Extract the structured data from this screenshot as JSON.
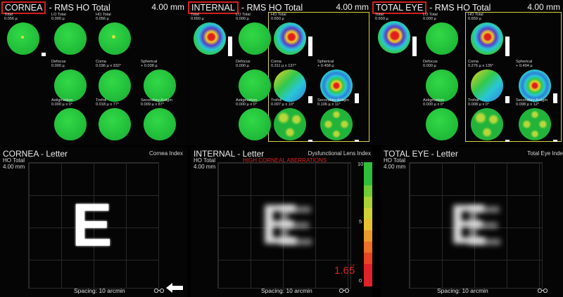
{
  "distance": "4.00 mm",
  "cornea_top": {
    "title": "CORNEA",
    "subtitle": "- RMS HO Total",
    "cells": [
      {
        "name": "Total",
        "value": "0.056 µ"
      },
      {
        "name": "LO Total",
        "value": "0.000 µ"
      },
      {
        "name": "HO Total",
        "value": "0.056 µ"
      },
      {
        "name": "Defocus",
        "value": "0.000 µ"
      },
      {
        "name": "Coma",
        "value": "0.036 µ x 332°"
      },
      {
        "name": "Spherical",
        "value": "+ 0.038 µ"
      },
      {
        "name": "Astigmatism",
        "value": "0.000 µ x 0°"
      },
      {
        "name": "Trefoil",
        "value": "0.018 µ x 77°"
      },
      {
        "name": "Secondary Astigm",
        "value": "0.009 µ x 87°"
      }
    ]
  },
  "internal_top": {
    "title": "INTERNAL",
    "subtitle": "- RMS HO Total",
    "cells": [
      {
        "name": "Total",
        "value": "0.650 µ"
      },
      {
        "name": "LO Total",
        "value": "0.000 µ"
      },
      {
        "name": "HO Total",
        "value": "0.650 µ"
      },
      {
        "name": "Defocus",
        "value": "0.000 µ"
      },
      {
        "name": "Coma",
        "value": "0.311 µ x 137°"
      },
      {
        "name": "Spherical",
        "value": "+ 0.458 µ"
      },
      {
        "name": "Astigmatism",
        "value": "0.000 µ x 0°"
      },
      {
        "name": "Trefoil",
        "value": "0.097 µ x 10°"
      },
      {
        "name": "Secondary Astigm",
        "value": "0.106 µ x 11°"
      }
    ]
  },
  "total_top": {
    "title": "TOTAL EYE",
    "subtitle": "- RMS HO Total",
    "cells": [
      {
        "name": "Total",
        "value": "0.659 µ"
      },
      {
        "name": "LO Total",
        "value": "0.000 µ"
      },
      {
        "name": "HO Total",
        "value": "0.659 µ"
      },
      {
        "name": "Defocus",
        "value": "0.000 µ"
      },
      {
        "name": "Coma",
        "value": "0.276 µ x 135°"
      },
      {
        "name": "Spherical",
        "value": "+ 0.494 µ"
      },
      {
        "name": "Astigmatism",
        "value": "0.000 µ x 0°"
      },
      {
        "name": "Trefoil",
        "value": "0.008 µ x 0°"
      },
      {
        "name": "Secondary Astigm",
        "value": "0.098 µ x 12°"
      }
    ]
  },
  "cornea_letter": {
    "title": "CORNEA - Letter",
    "index_label": "Cornea Index",
    "line1": "HO Total",
    "line2": "4.00 mm",
    "letter": "E",
    "spacing": "Spacing:  10 arcmin"
  },
  "internal_letter": {
    "title": "INTERNAL - Letter",
    "index_label": "Dysfunctional Lens Index",
    "warning": "HIGH CORNEAL ABERRATIONS",
    "line1": "HO Total",
    "line2": "4.00 mm",
    "letter": "E",
    "spacing": "Spacing:  10 arcmin",
    "scale": {
      "max": "10",
      "mid": "5",
      "min": "0",
      "value": "1.65",
      "value_num": 1.65
    }
  },
  "total_letter": {
    "title": "TOTAL EYE - Letter",
    "index_label": "Total Eye Inde",
    "line1": "HO Total",
    "line2": "4.00 mm",
    "letter": "E",
    "spacing": "Spacing:  10 arcmin"
  },
  "colors": {
    "highlight_box": "#d8d23a",
    "warning": "#e02020",
    "title_box": "#d21f1f"
  }
}
